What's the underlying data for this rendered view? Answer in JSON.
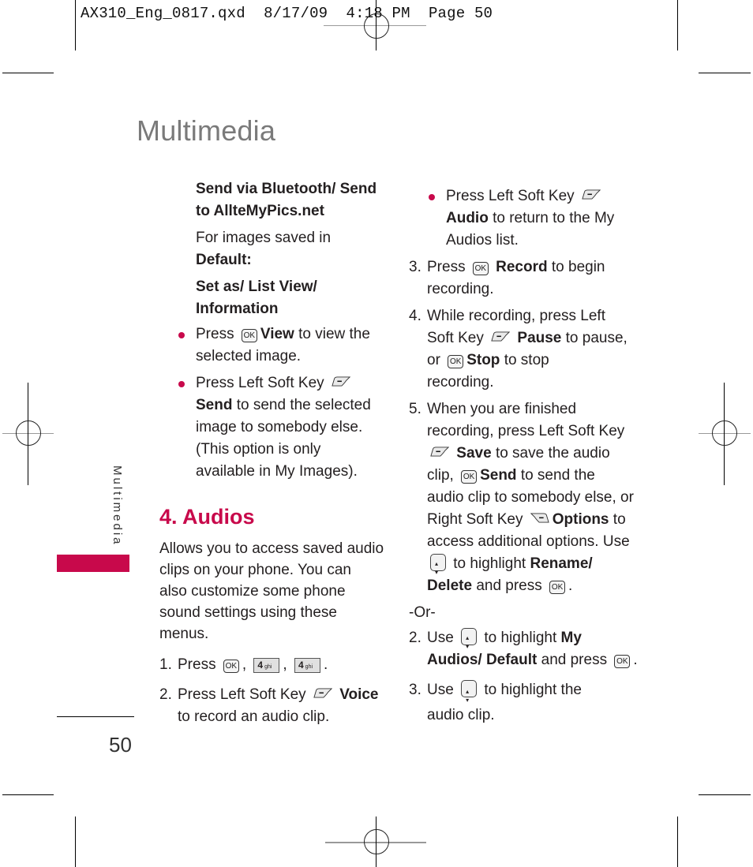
{
  "slug": {
    "file": "AX310_Eng_0817.qxd",
    "date": "8/17/09",
    "time": "4:18 PM",
    "page": "Page 50"
  },
  "page": {
    "title": "Multimedia",
    "sidebar_label": "Multimedia",
    "page_number": "50",
    "accent_color": "#c8094b"
  },
  "left_column": {
    "send_heading_1": "Send via Bluetooth/ Send",
    "send_heading_2": "to AllteMyPics.net",
    "default_intro": "For images saved in",
    "default_label": "Default:",
    "setas_1": "Set as/ List View/",
    "setas_2": "Information",
    "bullet1": {
      "pre": "Press",
      "key": "OK",
      "bold": "View",
      "post": "to view the",
      "line2": "selected image."
    },
    "bullet2": {
      "pre": "Press Left Soft Key",
      "bold": "Send",
      "post": "to send the selected",
      "line3": "image to somebody else.",
      "line4": "(This option is only",
      "line5": "available in My Images)."
    },
    "section_title": "4. Audios",
    "intro": [
      "Allows you to access saved audio",
      "clips on your phone. You can",
      "also customize some phone",
      "sound settings using these",
      "menus."
    ],
    "step1": {
      "num": "1.",
      "pre": "Press",
      "keys": [
        "OK",
        "4",
        "4"
      ],
      "key_sub": "ghi"
    },
    "step2": {
      "num": "2.",
      "pre": "Press Left Soft Key",
      "bold": "Voice",
      "line2": "to record an audio clip."
    }
  },
  "right_column": {
    "bullet": {
      "pre": "Press Left Soft Key",
      "bold": "Audio",
      "post": "to return to the My",
      "line3": "Audios list."
    },
    "step3": {
      "num": "3.",
      "pre": "Press",
      "bold": "Record",
      "post": "to begin",
      "line2": "recording."
    },
    "step4": {
      "num": "4.",
      "line1": "While recording, press Left",
      "pre2": "Soft Key",
      "bold2": "Pause",
      "post2": "to pause,",
      "pre3": "or",
      "bold3": "Stop",
      "post3": "to stop",
      "line4": "recording."
    },
    "step5": {
      "num": "5.",
      "line1": "When you are finished",
      "line2": "recording, press Left Soft Key",
      "bold3": "Save",
      "post3": "to save the audio",
      "pre4": "clip,",
      "bold4": "Send",
      "post4": "to send the",
      "line5": "audio clip to somebody else, or",
      "pre6": "Right Soft Key",
      "bold6": "Options",
      "post6": "to",
      "line7": "access additional options. Use",
      "pre8": "to highlight",
      "bold8": "Rename/",
      "bold9": "Delete",
      "post9": "and press"
    },
    "or": "-Or-",
    "alt2": {
      "num": "2.",
      "pre": "Use",
      "mid": "to highlight",
      "bold": "My",
      "bold2": "Audios/ Default",
      "post2": "and press"
    },
    "alt3": {
      "num": "3.",
      "pre": "Use",
      "mid": "to highlight the",
      "line2": "audio clip."
    }
  },
  "icons": {
    "ok_label": "OK",
    "key_digit": "4",
    "key_letters": "ghi"
  }
}
